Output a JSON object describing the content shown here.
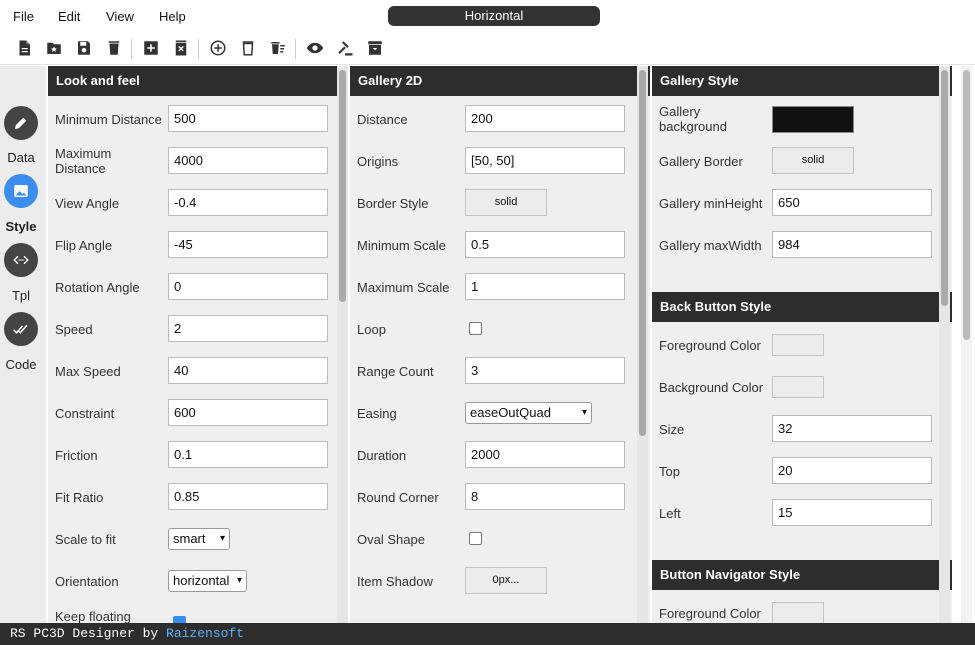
{
  "menu": {
    "file": "File",
    "edit": "Edit",
    "view": "View",
    "help": "Help"
  },
  "window_title": "Horizontal",
  "toolbar_icons": [
    "new-file-icon",
    "open-folder-icon",
    "save-icon",
    "delete-icon",
    "add-square-icon",
    "remove-square-icon",
    "add-circle-icon",
    "trash-icon",
    "delete-all-icon",
    "preview-eye-icon",
    "build-gavel-icon",
    "archive-icon"
  ],
  "nav": {
    "data": "Data",
    "style": "Style",
    "tpl": "Tpl",
    "code": "Code",
    "active": "Style"
  },
  "look_and_feel": {
    "title": "Look and feel",
    "rows": [
      {
        "label": "Minimum Distance",
        "value": "500"
      },
      {
        "label": "Maximum Distance",
        "value": "4000"
      },
      {
        "label": "View Angle",
        "value": "-0.4"
      },
      {
        "label": "Flip Angle",
        "value": "-45"
      },
      {
        "label": "Rotation Angle",
        "value": "0"
      },
      {
        "label": "Speed",
        "value": "2"
      },
      {
        "label": "Max Speed",
        "value": "40"
      },
      {
        "label": "Constraint",
        "value": "600"
      },
      {
        "label": "Friction",
        "value": "0.1"
      },
      {
        "label": "Fit Ratio",
        "value": "0.85"
      }
    ],
    "scale_to_fit_label": "Scale to fit",
    "scale_to_fit_value": "smart",
    "orientation_label": "Orientation",
    "orientation_value": "horizontal",
    "keep_floating_label": "Keep floating",
    "keep_floating_checked": true
  },
  "gallery2d": {
    "title": "Gallery 2D",
    "distance_label": "Distance",
    "distance_value": "200",
    "origins_label": "Origins",
    "origins_value": "[50, 50]",
    "border_style_label": "Border Style",
    "border_style_value": "solid",
    "min_scale_label": "Minimum Scale",
    "min_scale_value": "0.5",
    "max_scale_label": "Maximum Scale",
    "max_scale_value": "1",
    "loop_label": "Loop",
    "loop_checked": false,
    "range_count_label": "Range Count",
    "range_count_value": "3",
    "easing_label": "Easing",
    "easing_value": "easeOutQuad",
    "duration_label": "Duration",
    "duration_value": "2000",
    "round_corner_label": "Round Corner",
    "round_corner_value": "8",
    "oval_shape_label": "Oval Shape",
    "oval_shape_checked": false,
    "item_shadow_label": "Item Shadow",
    "item_shadow_value": "0px..."
  },
  "gallery_style": {
    "title": "Gallery Style",
    "background_label": "Gallery background",
    "background_color": "#111111",
    "border_label": "Gallery Border",
    "border_value": "solid",
    "min_height_label": "Gallery minHeight",
    "min_height_value": "650",
    "max_width_label": "Gallery maxWidth",
    "max_width_value": "984"
  },
  "back_button_style": {
    "title": "Back Button Style",
    "foreground_label": "Foreground Color",
    "background_label": "Background Color",
    "size_label": "Size",
    "size_value": "32",
    "top_label": "Top",
    "top_value": "20",
    "left_label": "Left",
    "left_value": "15"
  },
  "button_navigator_style": {
    "title": "Button Navigator Style",
    "foreground_label": "Foreground Color"
  },
  "status": {
    "prefix": "RS PC3D Designer by ",
    "brand": "Raizensoft"
  },
  "colors": {
    "accent": "#3b8ef0",
    "header": "#2d2d2d",
    "brand": "#5ab0ff"
  }
}
